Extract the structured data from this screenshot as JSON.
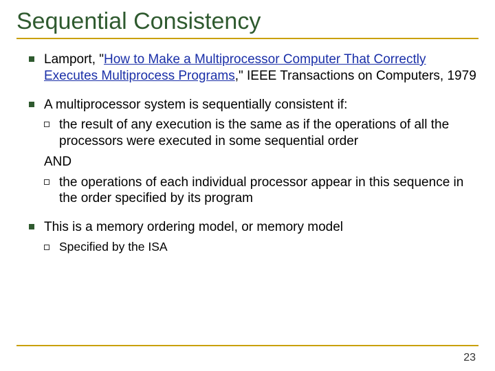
{
  "title": "Sequential Consistency",
  "b1": {
    "pre": "Lamport, \"",
    "link": "How to Make a Multiprocessor Computer That Correctly Executes Multiprocess Programs",
    "post": ",\" IEEE Transactions on Computers, 1979"
  },
  "b2": "A multiprocessor system is sequentially consistent if:",
  "b2a": "the result of any execution is the same as if the operations of all the processors were executed in some sequential order",
  "and": "AND",
  "b2b": "the operations of each individual processor appear in this sequence in the order specified by its program",
  "b3": "This is a memory ordering model, or memory model",
  "b3a": "Specified by the ISA",
  "page": "23"
}
